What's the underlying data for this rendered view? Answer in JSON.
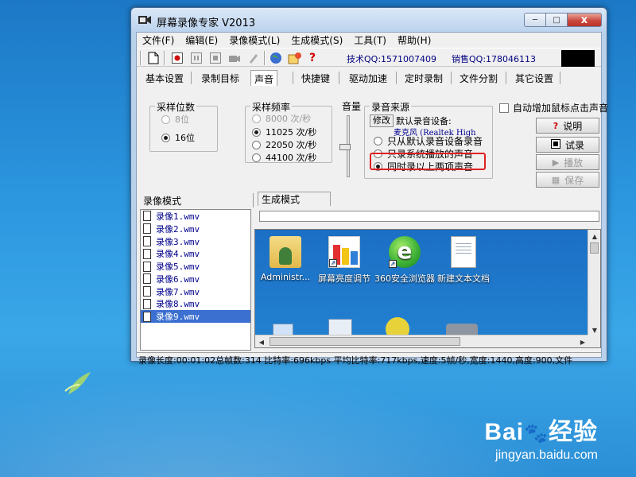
{
  "window": {
    "title": "屏幕录像专家 V2013",
    "close": "x",
    "minimize": "─",
    "maximize": "□"
  },
  "menu": [
    "文件(F)",
    "编辑(E)",
    "录像模式(L)",
    "生成模式(S)",
    "工具(T)",
    "帮助(H)"
  ],
  "toolbar": {
    "tech_qq": "技术QQ:1571007409",
    "sales_qq": "销售QQ:178046113"
  },
  "tabs": [
    "基本设置",
    "录制目标",
    "声音",
    "快捷键",
    "驱动加速",
    "定时录制",
    "文件分割",
    "其它设置"
  ],
  "active_tab": "声音",
  "sample_bits": {
    "title": "采样位数",
    "options": [
      "8位",
      "16位"
    ],
    "selected": "16位"
  },
  "sample_rate": {
    "title": "采样频率",
    "options": [
      "8000 次/秒",
      "11025 次/秒",
      "22050 次/秒",
      "44100 次/秒"
    ],
    "selected": "11025 次/秒"
  },
  "volume": {
    "label": "音量"
  },
  "sound_source": {
    "title": "录音来源",
    "modify": "修改",
    "default_label": "默认录音设备:",
    "device": "麦克风 (Realtek High",
    "options": [
      "只从默认录音设备录音",
      "只录系统播放的声音",
      "同时录以上两项声音"
    ],
    "selected": "同时录以上两项声音"
  },
  "mouse_click_checkbox": "自动增加鼠标点击声音",
  "side_buttons": {
    "help": "说明",
    "test": "试录",
    "play": "播放",
    "save": "保存"
  },
  "record_mode_label": "录像模式",
  "generate_mode_label": "生成模式",
  "files": [
    "录像1.wmv",
    "录像2.wmv",
    "录像3.wmv",
    "录像4.wmv",
    "录像5.wmv",
    "录像6.wmv",
    "录像7.wmv",
    "录像8.wmv",
    "录像9.wmv"
  ],
  "selected_file": "录像9.wmv",
  "desktop_icons": [
    {
      "label": "Administr...",
      "icon": "user-folder-icon"
    },
    {
      "label": "屏幕亮度调节",
      "icon": "brightness-app-icon"
    },
    {
      "label": "360安全浏览器",
      "icon": "browser-icon"
    },
    {
      "label": "新建文本文档",
      "icon": "text-document-icon"
    }
  ],
  "status": "录像长度:00:01:02总帧数:314 比特率:696kbps 平均比特率:717kbps,速度:5帧/秒,宽度:1440,高度:900,文件",
  "watermark": {
    "brand": "Bai",
    "brand2": "经验",
    "url": "jingyan.baidu.com"
  }
}
